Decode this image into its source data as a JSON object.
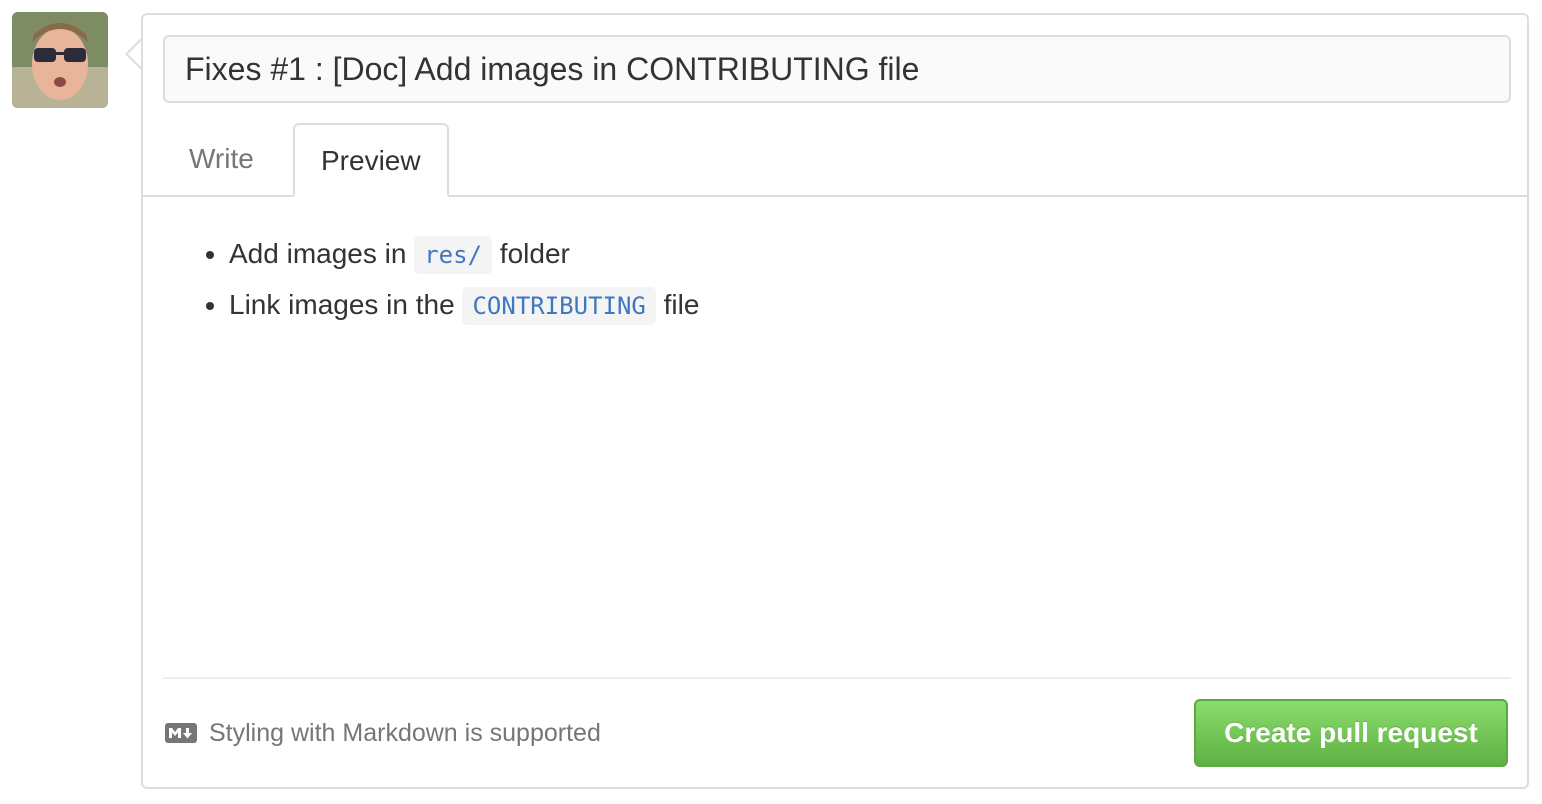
{
  "avatar": {
    "icon": "user-avatar"
  },
  "pull_request": {
    "title_value": "Fixes #1 : [Doc] Add images in CONTRIBUTING file",
    "tabs": [
      {
        "label": "Write",
        "active": false
      },
      {
        "label": "Preview",
        "active": true
      }
    ],
    "preview_items": [
      {
        "before": "Add images in",
        "code": "res/",
        "after": "folder"
      },
      {
        "before": "Link images in the",
        "code": "CONTRIBUTING",
        "after": "file"
      }
    ],
    "markdown_hint": "Styling with Markdown is supported",
    "markdown_icon": "markdown-icon",
    "submit_label": "Create pull request"
  },
  "colors": {
    "button_green": "#60b044",
    "code_blue": "#4078c0",
    "border": "#dddddd"
  }
}
